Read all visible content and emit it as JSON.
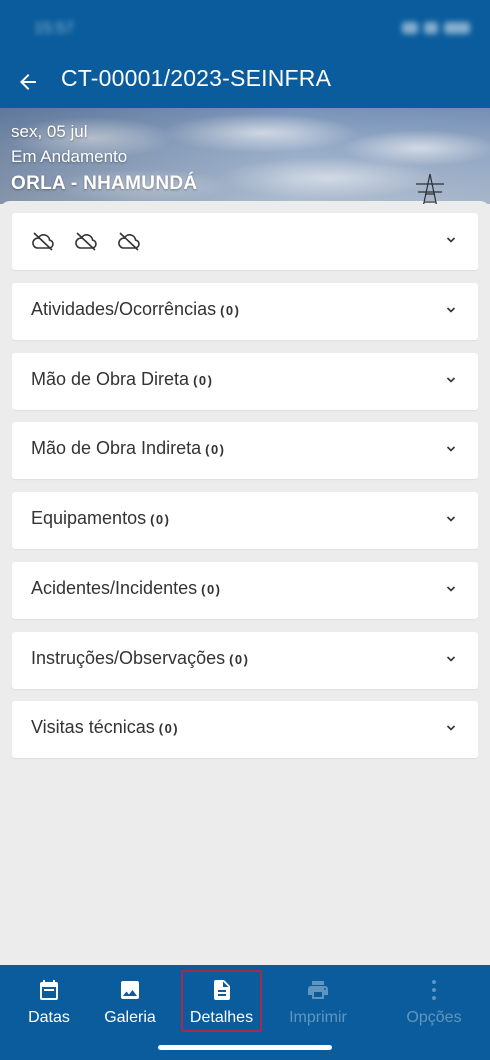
{
  "status_bar": {
    "time": "15:57"
  },
  "app_bar": {
    "title": "CT-00001/2023-SEINFRA"
  },
  "hero": {
    "date": "sex, 05 jul",
    "status": "Em Andamento",
    "name": "ORLA - NHAMUNDÁ"
  },
  "weather": {
    "icons": [
      "cloud-off-icon",
      "cloud-off-icon",
      "cloud-off-icon"
    ]
  },
  "sections": [
    {
      "label": "Atividades/Ocorrências",
      "count": "(0)"
    },
    {
      "label": "Mão de Obra Direta",
      "count": "(0)"
    },
    {
      "label": "Mão de Obra Indireta",
      "count": "(0)"
    },
    {
      "label": "Equipamentos",
      "count": "(0)"
    },
    {
      "label": "Acidentes/Incidentes",
      "count": "(0)"
    },
    {
      "label": "Instruções/Observações",
      "count": "(0)"
    },
    {
      "label": "Visitas técnicas",
      "count": "(0)"
    }
  ],
  "bottom_nav": {
    "items": [
      {
        "label": "Datas",
        "icon": "calendar-icon",
        "enabled": true
      },
      {
        "label": "Galeria",
        "icon": "image-icon",
        "enabled": true
      },
      {
        "label": "Detalhes",
        "icon": "document-icon",
        "enabled": true,
        "selected": true
      },
      {
        "label": "Imprimir",
        "icon": "printer-icon",
        "enabled": false
      },
      {
        "label": "Opções",
        "icon": "more-vertical-icon",
        "enabled": false
      }
    ]
  },
  "colors": {
    "primary": "#0a5c9c",
    "background": "#ececec",
    "card": "#ffffff",
    "selection_border": "#a8284a"
  }
}
